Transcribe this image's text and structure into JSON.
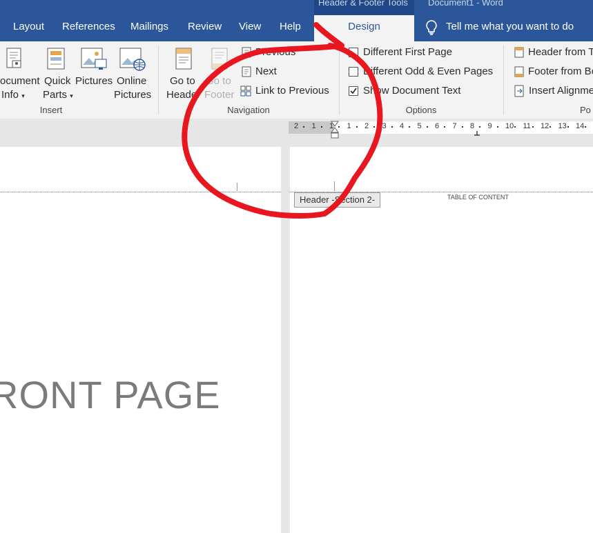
{
  "window": {
    "contextual_label": "Header & Footer Tools",
    "doc_title": "Document1 - Word"
  },
  "tabs": [
    {
      "label": "Layout"
    },
    {
      "label": "References"
    },
    {
      "label": "Mailings"
    },
    {
      "label": "Review"
    },
    {
      "label": "View"
    },
    {
      "label": "Help"
    },
    {
      "label": "Design",
      "active": true
    }
  ],
  "tellme": {
    "text": "Tell me what you want to do"
  },
  "ribbon": {
    "insert": {
      "document_info_line1": "ocument",
      "document_info_line2": "Info",
      "quick_parts_line1": "Quick",
      "quick_parts_line2": "Parts",
      "pictures": "Pictures",
      "online_pictures_line1": "Online",
      "online_pictures_line2": "Pictures",
      "group": "Insert"
    },
    "navigation": {
      "goto_header_line1": "Go to",
      "goto_header_line2": "Header",
      "goto_footer_line1": "Go to",
      "goto_footer_line2": "Footer",
      "previous": "Previous",
      "next": "Next",
      "link_to_previous": "Link to Previous",
      "group": "Navigation"
    },
    "options": {
      "different_first_page": "Different First Page",
      "different_odd_even": "Different Odd & Even Pages",
      "show_document_text": "Show Document Text",
      "show_document_text_checked": true,
      "group": "Options"
    },
    "position": {
      "header_from_top": "Header from T",
      "footer_from_bottom": "Footer from Bo",
      "insert_alignment": "Insert Alignme",
      "group": "Po"
    }
  },
  "ruler": {
    "labels": [
      "2",
      "1",
      "1",
      "1",
      "2",
      "3",
      "4",
      "5",
      "6",
      "7",
      "8",
      "9",
      "10",
      "11",
      "12",
      "13",
      "14"
    ]
  },
  "document": {
    "header_tag": "Header -Section 2-",
    "toc_text": "TABLE OF CONTENT",
    "front_page_text": "RONT PAGE"
  },
  "colors": {
    "brand": "#2b579a",
    "annotation": "#e8171f"
  }
}
